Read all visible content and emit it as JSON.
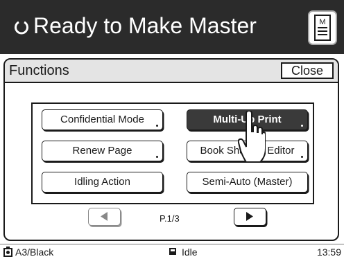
{
  "header": {
    "status_icon": "refresh-circle-icon",
    "title": "Ready to Make Master",
    "master_icon": "master-document-icon",
    "master_icon_letter": "M"
  },
  "panel": {
    "title": "Functions",
    "close_label": "Close"
  },
  "functions": [
    {
      "label": "Confidential Mode"
    },
    {
      "label": "Multi-Up Print",
      "selected": true
    },
    {
      "label": "Renew Page"
    },
    {
      "label": "Book Shadow Editor"
    },
    {
      "label": "Idling Action"
    },
    {
      "label": "Semi-Auto (Master)"
    }
  ],
  "pagination": {
    "prev_icon": "triangle-left-icon",
    "next_icon": "triangle-right-icon",
    "page_label": "P.1/3",
    "prev_enabled": false
  },
  "statusbar": {
    "paper_icon": "drum-icon",
    "paper": "A3/Black",
    "state_icon": "square-icon",
    "state": "Idle",
    "time": "13:59"
  },
  "colors": {
    "header_bg": "#2b2b2b",
    "selected_button_bg": "#3a3a3a"
  }
}
